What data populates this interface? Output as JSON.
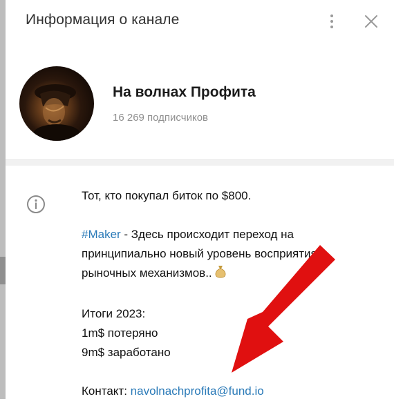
{
  "header": {
    "title": "Информация о канале"
  },
  "channel": {
    "name": "На волнах Профита",
    "subscribers": "16 269 подписчиков"
  },
  "description": {
    "line1": "Тот, кто покупал биток по $800.",
    "hashtag": "#Maker",
    "line2_rest": " - Здесь происходит переход на",
    "line3": "принципиально новый уровень восприятия",
    "line4": "рыночных механизмов.. ",
    "results_title": "Итоги 2023:",
    "lost": "1m$ потеряно",
    "earned": "9m$ заработано",
    "contact_label": "Контакт: ",
    "contact_email": "navolnachprofita@fund.io"
  },
  "colors": {
    "link": "#2a7ab8",
    "arrow": "#e01010",
    "muted_text": "#8e8e8e"
  },
  "icons": {
    "menu": "more-vertical-icon",
    "close": "close-icon",
    "info": "info-icon",
    "emoji": "money-bag-icon"
  }
}
